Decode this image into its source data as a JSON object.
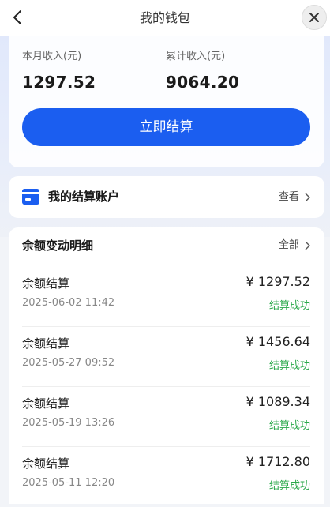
{
  "nav": {
    "title": "我的钱包"
  },
  "income": {
    "month_label": "本月收入(元)",
    "month_value": "1297.52",
    "total_label": "累计收入(元)",
    "total_value": "9064.20",
    "settle_button": "立即结算"
  },
  "account": {
    "title": "我的结算账户",
    "link": "查看"
  },
  "detail": {
    "title": "余额变动明细",
    "link": "全部",
    "rows": [
      {
        "name": "余额结算",
        "date": "2025-06-02 11:42",
        "amount": "¥ 1297.52",
        "status": "结算成功"
      },
      {
        "name": "余额结算",
        "date": "2025-05-27 09:52",
        "amount": "¥ 1456.64",
        "status": "结算成功"
      },
      {
        "name": "余额结算",
        "date": "2025-05-19 13:26",
        "amount": "¥ 1089.34",
        "status": "结算成功"
      },
      {
        "name": "余额结算",
        "date": "2025-05-11 12:20",
        "amount": "¥ 1712.80",
        "status": "结算成功"
      }
    ]
  },
  "colors": {
    "primary": "#1b5ef0",
    "success": "#2aa84a"
  },
  "icons": {
    "back": "chevron-left-icon",
    "close": "close-icon",
    "account": "card-icon",
    "link_arrow": "chevron-right-icon"
  }
}
